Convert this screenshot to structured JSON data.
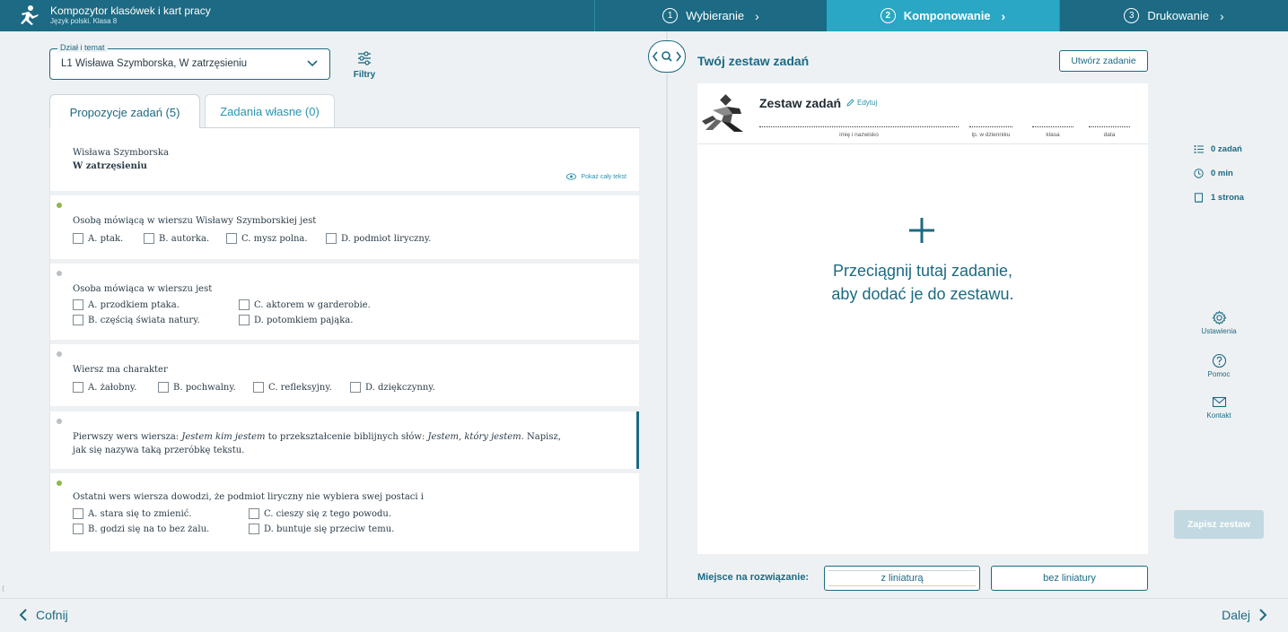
{
  "header": {
    "title": "Kompozytor klasówek i kart pracy",
    "subtitle": "Język polski. Klasa 8",
    "steps": [
      {
        "num": "1",
        "label": "Wybieranie"
      },
      {
        "num": "2",
        "label": "Komponowanie"
      },
      {
        "num": "3",
        "label": "Drukowanie"
      }
    ]
  },
  "left": {
    "select_legend": "Dział i temat",
    "select_value": "L1 Wisława Szymborska, W zatrzęsieniu",
    "filters_label": "Filtry",
    "tabs": [
      {
        "label": "Propozycje zadań (5)"
      },
      {
        "label": "Zadania własne (0)"
      }
    ],
    "text_card": {
      "author": "Wisława Szymborska",
      "title": "W zatrzęsieniu",
      "show_label": "Pokaż cały tekst"
    },
    "tasks": [
      {
        "question": "Osobą mówiącą w wierszu Wisławy Szymborskiej jest",
        "options": [
          "A. ptak.",
          "B. autorka.",
          "C. mysz polna.",
          "D. podmiot liryczny."
        ]
      },
      {
        "question": "Osoba mówiąca w wierszu jest",
        "options": [
          "A. przodkiem ptaka.",
          "B. częścią świata natury.",
          "C. aktorem w garderobie.",
          "D. potomkiem pająka."
        ]
      },
      {
        "question": "Wiersz ma charakter",
        "options": [
          "A. żałobny.",
          "B. pochwalny.",
          "C. refleksyjny.",
          "D. dziękczynny."
        ]
      },
      {
        "q_part1": "Pierwszy wers wiersza: ",
        "q_italic1": "Jestem kim jestem",
        "q_part2": " to przekształcenie biblijnych słów: ",
        "q_italic2": "Jestem, który jestem",
        "q_part3": ". Napisz,",
        "q_line2": "jak się nazywa taką przeróbkę tekstu."
      },
      {
        "question": "Ostatni wers wiersza dowodzi, że podmiot liryczny nie wybiera swej postaci i",
        "options": [
          "A. stara się to zmienić.",
          "B. godzi się na to bez żalu.",
          "C. cieszy się z tego powodu.",
          "D. buntuje się przeciw temu."
        ]
      }
    ]
  },
  "right": {
    "title": "Twój zestaw zadań",
    "create_label": "Utwórz zadanie",
    "paper": {
      "title": "Zestaw zadań",
      "edit_label": "Edytuj",
      "fields": [
        "imię i nazwisko",
        "lp. w dzienniku",
        "klasa",
        "data"
      ]
    },
    "drop_line1": "Przeciągnij tutaj zadanie,",
    "drop_line2": "aby dodać je do zestawu.",
    "space_label": "Miejsce na rozwiązanie:",
    "lined_label": "z liniaturą",
    "plain_label": "bez liniatury"
  },
  "sidebar": {
    "tasks_count": "0 zadań",
    "time": "0 min",
    "pages": "1 strona",
    "settings": "Ustawienia",
    "help": "Pomoc",
    "contact": "Kontakt",
    "save_label": "Zapisz zestaw"
  },
  "footer": {
    "back": "Cofnij",
    "next": "Dalej"
  },
  "colors": {
    "primary": "#1c6a83",
    "active_step": "#29a7c4",
    "accent_green": "#8cb84a"
  }
}
